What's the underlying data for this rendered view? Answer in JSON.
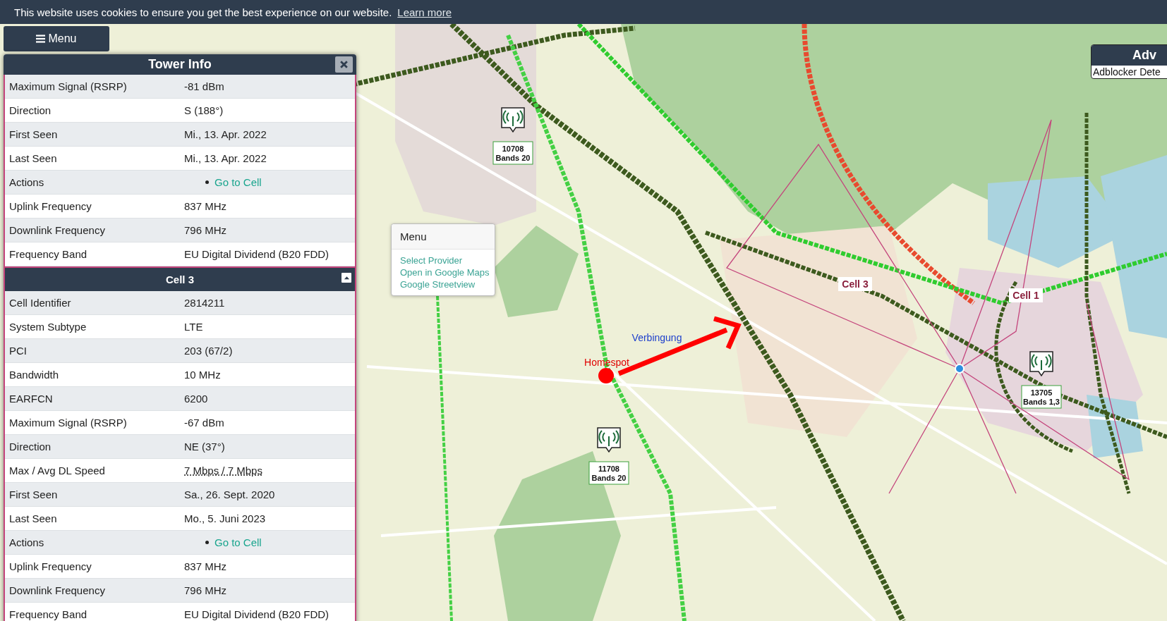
{
  "cookie_banner": {
    "text": "This website uses cookies to ensure you get the best experience on our website.",
    "link": "Learn more"
  },
  "menu_button": {
    "label": "Menu"
  },
  "tower_info": {
    "title": "Tower Info",
    "sections": [
      {
        "rows": [
          {
            "label": "Maximum Signal (RSRP)",
            "value": "-81 dBm",
            "kind": "text"
          },
          {
            "label": "Direction",
            "value": "S (188°)",
            "kind": "text"
          },
          {
            "label": "First Seen",
            "value": "Mi., 13. Apr. 2022",
            "kind": "text"
          },
          {
            "label": "Last Seen",
            "value": "Mi., 13. Apr. 2022",
            "kind": "text"
          },
          {
            "label": "Actions",
            "value": "Go to Cell",
            "kind": "link"
          },
          {
            "label": "Uplink Frequency",
            "value": "837 MHz",
            "kind": "text"
          },
          {
            "label": "Downlink Frequency",
            "value": "796 MHz",
            "kind": "text"
          },
          {
            "label": "Frequency Band",
            "value": "EU Digital Dividend (B20 FDD)",
            "kind": "text"
          }
        ]
      },
      {
        "title": "Cell 3",
        "expanded": true,
        "rows": [
          {
            "label": "Cell Identifier",
            "value": "2814211",
            "kind": "text"
          },
          {
            "label": "System Subtype",
            "value": "LTE",
            "kind": "text"
          },
          {
            "label": "PCI",
            "value": "203 (67/2)",
            "kind": "text"
          },
          {
            "label": "Bandwidth",
            "value": "10 MHz",
            "kind": "text"
          },
          {
            "label": "EARFCN",
            "value": "6200",
            "kind": "text"
          },
          {
            "label": "Maximum Signal (RSRP)",
            "value": "-67 dBm",
            "kind": "text"
          },
          {
            "label": "Direction",
            "value": "NE (37°)",
            "kind": "text"
          },
          {
            "label": "Max / Avg DL Speed",
            "value": "7 Mbps / 7 Mbps",
            "kind": "abbr"
          },
          {
            "label": "First Seen",
            "value": "Sa., 26. Sept. 2020",
            "kind": "text"
          },
          {
            "label": "Last Seen",
            "value": "Mo., 5. Juni 2023",
            "kind": "text"
          },
          {
            "label": "Actions",
            "value": "Go to Cell",
            "kind": "link"
          },
          {
            "label": "Uplink Frequency",
            "value": "837 MHz",
            "kind": "text"
          },
          {
            "label": "Downlink Frequency",
            "value": "796 MHz",
            "kind": "text"
          },
          {
            "label": "Frequency Band",
            "value": "EU Digital Dividend (B20 FDD)",
            "kind": "text"
          }
        ]
      }
    ]
  },
  "map": {
    "towers": [
      {
        "id_text": "10708",
        "bands": "Bands 20"
      },
      {
        "id_text": "11708",
        "bands": "Bands 20"
      },
      {
        "id_text": "13705",
        "bands": "Bands 1,3"
      }
    ],
    "cell_labels": [
      "Cell 3",
      "Cell 1"
    ],
    "homespot": {
      "label": "Homespot"
    },
    "connection": {
      "label": "Verbingung"
    },
    "context_menu": {
      "title": "Menu",
      "items": [
        "Select Provider",
        "Open in Google Maps",
        "Google Streetview"
      ]
    }
  },
  "adblock_notice": {
    "title": "Adv",
    "text": "Adblocker Dete"
  }
}
